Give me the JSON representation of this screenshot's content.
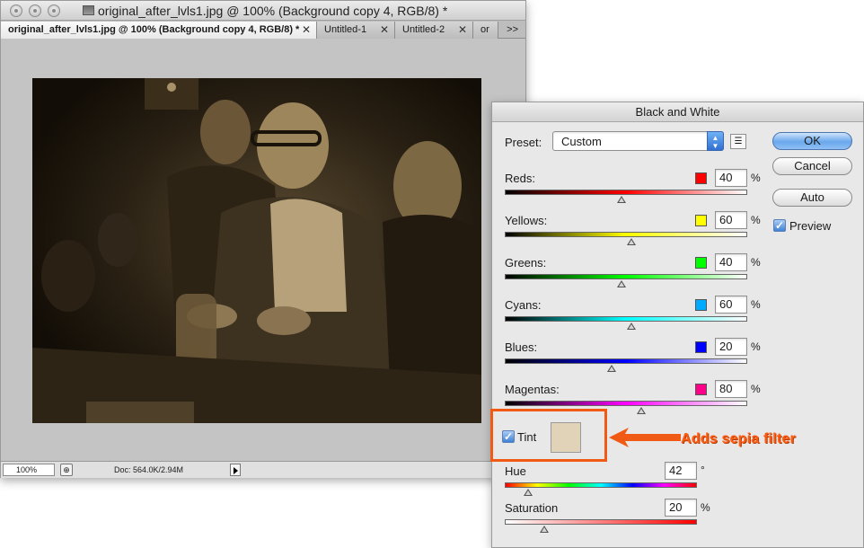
{
  "document_window": {
    "title": "original_after_lvls1.jpg @ 100% (Background copy 4, RGB/8) *",
    "tabs": [
      {
        "label": "original_after_lvls1.jpg @ 100% (Background copy 4, RGB/8) *",
        "active": true
      },
      {
        "label": "Untitled-1",
        "active": false
      },
      {
        "label": "Untitled-2",
        "active": false
      },
      {
        "label": "or",
        "active": false
      }
    ],
    "tab_overflow": ">>",
    "close_glyph": "✕",
    "status": {
      "zoom": "100%",
      "doc_info": "Doc: 564.0K/2.94M"
    }
  },
  "dialog": {
    "title": "Black and White",
    "preset_label": "Preset:",
    "preset_value": "Custom",
    "buttons": {
      "ok": "OK",
      "cancel": "Cancel",
      "auto": "Auto"
    },
    "preview_label": "Preview",
    "preview_checked": true,
    "percent": "%",
    "degree": "°",
    "sliders": [
      {
        "label": "Reds:",
        "value": "40",
        "swatch": "#ff0000",
        "gradient": [
          "#000000",
          "#ff0000",
          "#ffffff"
        ]
      },
      {
        "label": "Yellows:",
        "value": "60",
        "swatch": "#ffff00",
        "gradient": [
          "#000000",
          "#ffff00",
          "#ffffff"
        ]
      },
      {
        "label": "Greens:",
        "value": "40",
        "swatch": "#00ff00",
        "gradient": [
          "#000000",
          "#00ff00",
          "#ffffff"
        ]
      },
      {
        "label": "Cyans:",
        "value": "60",
        "swatch": "#00aaff",
        "gradient": [
          "#000000",
          "#00ffff",
          "#ffffff"
        ]
      },
      {
        "label": "Blues:",
        "value": "20",
        "swatch": "#0000ff",
        "gradient": [
          "#000000",
          "#0000ff",
          "#ffffff"
        ]
      },
      {
        "label": "Magentas:",
        "value": "80",
        "swatch": "#ff0088",
        "gradient": [
          "#000000",
          "#ff00ff",
          "#ffffff"
        ]
      }
    ],
    "tint_label": "Tint",
    "tint_checked": true,
    "tint_color": "#e1d3b8",
    "hue_label": "Hue",
    "hue_value": "42",
    "saturation_label": "Saturation",
    "saturation_value": "20"
  },
  "annotation": {
    "text": "Adds sepia filter",
    "color": "#f05a14"
  }
}
